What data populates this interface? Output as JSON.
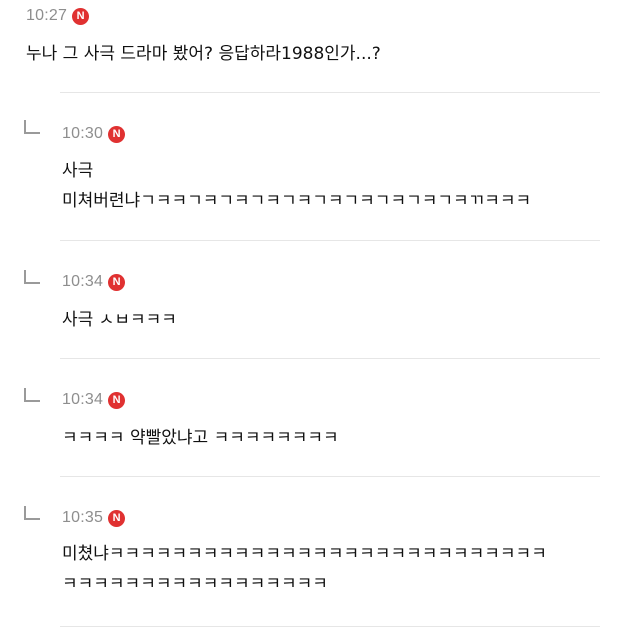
{
  "main_comment": {
    "time": "10:27",
    "badge": "N",
    "text": "누나 그 사극 드라마 봤어? 응답하라1988인가...?"
  },
  "replies": [
    {
      "time": "10:30",
      "badge": "N",
      "lines": [
        "사극",
        "미쳐버련냐ㄱㅋㅋㄱㅋㄱㅋㄱㅋㄱㅋㄱㅋㄱㅋㄱㅋㄱㅋㄱㅋㄲㅋㅋㅋ"
      ]
    },
    {
      "time": "10:34",
      "badge": "N",
      "lines": [
        "사극 ㅅㅂㅋㅋㅋ"
      ]
    },
    {
      "time": "10:34",
      "badge": "N",
      "lines": [
        "ㅋㅋㅋㅋ 약빨았냐고 ㅋㅋㅋㅋㅋㅋㅋㅋ"
      ]
    },
    {
      "time": "10:35",
      "badge": "N",
      "lines": [
        "미쳤냐ㅋㅋㅋㅋㅋㅋㅋㅋㅋㅋㅋㅋㅋㅋㅋㅋㅋㅋㅋㅋㅋㅋㅋㅋㅋㅋㅋㅋ",
        "ㅋㅋㅋㅋㅋㅋㅋㅋㅋㅋㅋㅋㅋㅋㅋㅋㅋ"
      ]
    }
  ],
  "colors": {
    "badge_bg": "#e03131",
    "time_text": "#8e8e8e",
    "divider": "#e6e6e6"
  },
  "icons": {
    "badge": "new-badge-icon",
    "reply": "reply-arrow-icon"
  }
}
